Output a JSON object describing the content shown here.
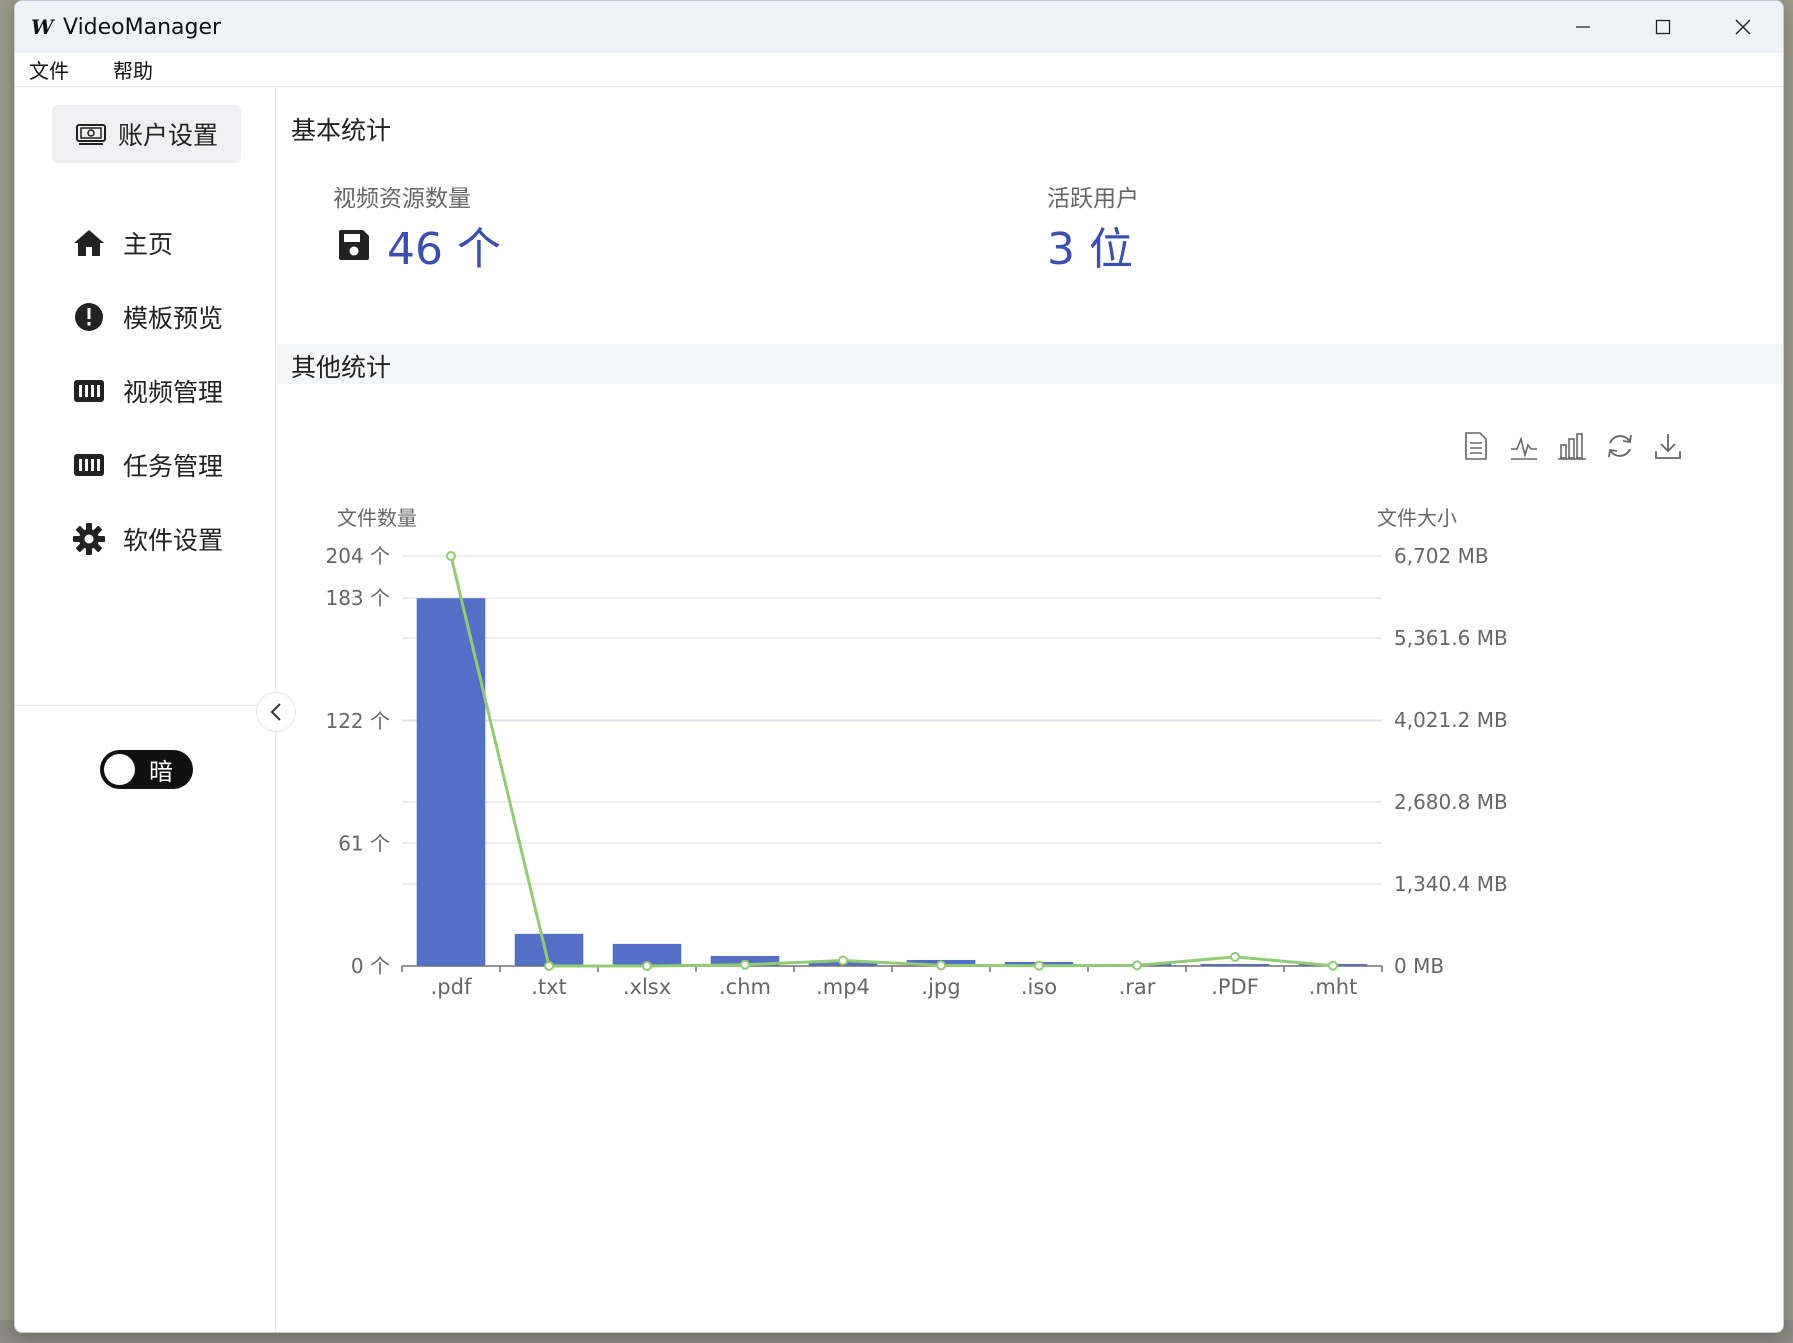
{
  "window": {
    "title": "VideoManager",
    "logo": "W"
  },
  "controls": {
    "minimize": "─",
    "maximize": "☐",
    "close": "✕"
  },
  "menu": {
    "items": [
      "文件",
      "帮助"
    ]
  },
  "sidebar": {
    "account_label": "账户设置",
    "items": [
      {
        "label": "主页",
        "icon": "home-icon"
      },
      {
        "label": "模板预览",
        "icon": "alert-circle-icon"
      },
      {
        "label": "视频管理",
        "icon": "film-icon"
      },
      {
        "label": "任务管理",
        "icon": "film-icon"
      },
      {
        "label": "软件设置",
        "icon": "gear-icon"
      }
    ],
    "theme_toggle_label": "暗"
  },
  "main": {
    "basic_title": "基本统计",
    "stats": [
      {
        "label": "视频资源数量",
        "value": "46 个",
        "icon": "save-icon"
      },
      {
        "label": "活跃用户",
        "value": "3 位"
      }
    ],
    "other_title": "其他统计"
  },
  "colors": {
    "bar": "#5470c6",
    "line": "#91cc75",
    "value": "#3a4fb0"
  },
  "chart_data": {
    "type": "bar",
    "categories": [
      ".pdf",
      ".txt",
      ".xlsx",
      ".chm",
      ".mp4",
      ".jpg",
      ".iso",
      ".rar",
      ".PDF",
      ".mht"
    ],
    "series": [
      {
        "type": "bar",
        "axis": "left",
        "values": [
          183,
          16,
          11,
          5,
          2,
          3,
          2,
          1,
          1,
          1
        ]
      },
      {
        "type": "line",
        "axis": "right",
        "values": [
          6702,
          0,
          0,
          20,
          90,
          10,
          5,
          10,
          150,
          5
        ]
      }
    ],
    "y_left": {
      "label": "文件数量",
      "ylim": [
        0,
        204
      ],
      "ticks": [
        "0 个",
        "61 个",
        "122 个",
        "183 个",
        "204 个"
      ]
    },
    "y_right": {
      "label": "文件大小",
      "ylim": [
        0,
        6702
      ],
      "ticks": [
        "0 MB",
        "1,340.4 MB",
        "2,680.8 MB",
        "4,021.2 MB",
        "5,361.6 MB",
        "6,702 MB"
      ]
    },
    "grid": true
  }
}
